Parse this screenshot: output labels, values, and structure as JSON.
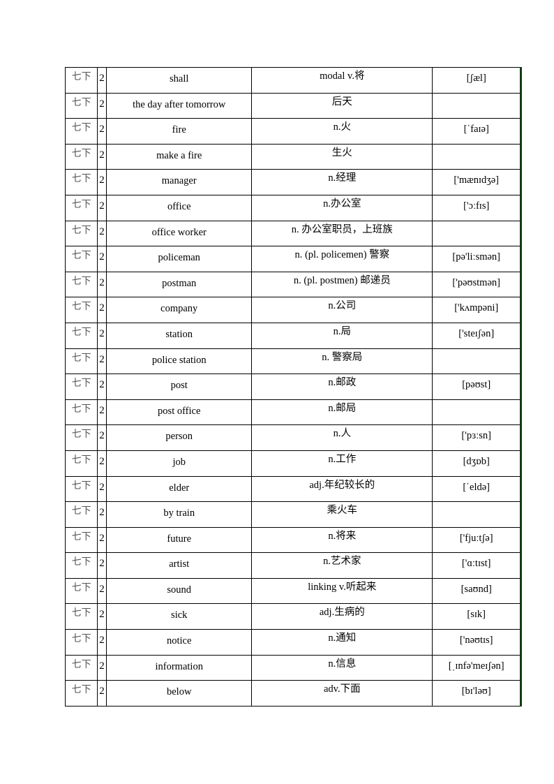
{
  "table": {
    "rows": [
      {
        "grade": "七下",
        "unit": "2",
        "word": "shall",
        "meaning": "modal v.将",
        "phonetic": "[ʃæl]"
      },
      {
        "grade": "七下",
        "unit": "2",
        "word": "the day after tomorrow",
        "meaning": "后天",
        "phonetic": ""
      },
      {
        "grade": "七下",
        "unit": "2",
        "word": "fire",
        "meaning": "n.火",
        "phonetic": "[ˈfaɪə]"
      },
      {
        "grade": "七下",
        "unit": "2",
        "word": "make a fire",
        "meaning": "生火",
        "phonetic": ""
      },
      {
        "grade": "七下",
        "unit": "2",
        "word": "manager",
        "meaning": "n.经理",
        "phonetic": "['mænɪdʒə]"
      },
      {
        "grade": "七下",
        "unit": "2",
        "word": "office",
        "meaning": "n.办公室",
        "phonetic": "['ɔːfɪs]"
      },
      {
        "grade": "七下",
        "unit": "2",
        "word": "office worker",
        "meaning": "n. 办公室职员，上班族",
        "phonetic": ""
      },
      {
        "grade": "七下",
        "unit": "2",
        "word": "policeman",
        "meaning": "n. (pl. policemen)  警察",
        "phonetic": "[pə'liːsmən]"
      },
      {
        "grade": "七下",
        "unit": "2",
        "word": "postman",
        "meaning": "n. (pl. postmen)  邮递员",
        "phonetic": "['pəʊstmən]"
      },
      {
        "grade": "七下",
        "unit": "2",
        "word": "company",
        "meaning": "n.公司",
        "phonetic": "['kʌmpəni]"
      },
      {
        "grade": "七下",
        "unit": "2",
        "word": "station",
        "meaning": "n.局",
        "phonetic": "['steɪʃən]"
      },
      {
        "grade": "七下",
        "unit": "2",
        "word": "police station",
        "meaning": "n.  警察局",
        "phonetic": ""
      },
      {
        "grade": "七下",
        "unit": "2",
        "word": "post",
        "meaning": "n.邮政",
        "phonetic": "[pəʊst]"
      },
      {
        "grade": "七下",
        "unit": "2",
        "word": "post office",
        "meaning": "n.邮局",
        "phonetic": ""
      },
      {
        "grade": "七下",
        "unit": "2",
        "word": "person",
        "meaning": "n.人",
        "phonetic": "['pɜːsn]"
      },
      {
        "grade": "七下",
        "unit": "2",
        "word": "job",
        "meaning": "n.工作",
        "phonetic": "[dʒɒb]"
      },
      {
        "grade": "七下",
        "unit": "2",
        "word": "elder",
        "meaning": "adj.年纪较长的",
        "phonetic": "[ˈeldə]"
      },
      {
        "grade": "七下",
        "unit": "2",
        "word": "by train",
        "meaning": "乘火车",
        "phonetic": ""
      },
      {
        "grade": "七下",
        "unit": "2",
        "word": "future",
        "meaning": "n.将来",
        "phonetic": "['fjuːtʃə]"
      },
      {
        "grade": "七下",
        "unit": "2",
        "word": "artist",
        "meaning": "n.艺术家",
        "phonetic": "['ɑːtɪst]"
      },
      {
        "grade": "七下",
        "unit": "2",
        "word": "sound",
        "meaning": "linking v.听起来",
        "phonetic": "[saʊnd]"
      },
      {
        "grade": "七下",
        "unit": "2",
        "word": "sick",
        "meaning": "adj.生病的",
        "phonetic": "[sɪk]"
      },
      {
        "grade": "七下",
        "unit": "2",
        "word": "notice",
        "meaning": "n.通知",
        "phonetic": "['nəʊtɪs]"
      },
      {
        "grade": "七下",
        "unit": "2",
        "word": "information",
        "meaning": "n.信息",
        "phonetic": "[ˌɪnfə'meɪʃən]"
      },
      {
        "grade": "七下",
        "unit": "2",
        "word": "below",
        "meaning": "adv.下面",
        "phonetic": "[bɪ'ləʊ]"
      }
    ]
  }
}
